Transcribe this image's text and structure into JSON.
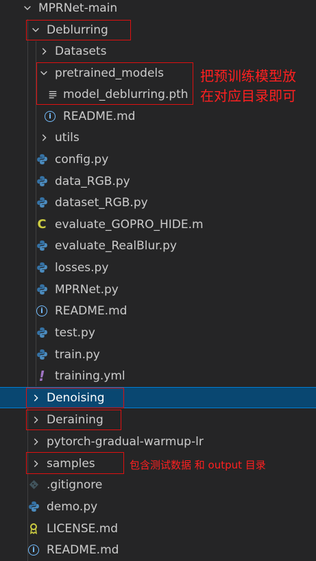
{
  "explorer": {
    "root_label": "MPRNet-main",
    "deblurring": "Deblurring",
    "datasets": "Datasets",
    "pretrained_models": "pretrained_models",
    "model_file": "model_deblurring.pth",
    "readme_sub": "README.md",
    "utils": "utils",
    "config": "config.py",
    "data_rgb": "data_RGB.py",
    "dataset_rgb": "dataset_RGB.py",
    "evaluate_gopro": "evaluate_GOPRO_HIDE.m",
    "evaluate_realblur": "evaluate_RealBlur.py",
    "losses": "losses.py",
    "mprnet": "MPRNet.py",
    "readme_deblur": "README.md",
    "test": "test.py",
    "train": "train.py",
    "training_yml": "training.yml",
    "denoising": "Denoising",
    "deraining": "Deraining",
    "pytorch_warmup": "pytorch-gradual-warmup-lr",
    "samples": "samples",
    "gitignore": ".gitignore",
    "demo": "demo.py",
    "license": "LICENSE.md",
    "readme_root": "README.md"
  },
  "annotations": {
    "note_pretrained_line1": "把预训练模型放",
    "note_pretrained_line2": "在对应目录即可",
    "note_samples": "包含测试数据  和 output 目录"
  },
  "colors": {
    "background": "#252526",
    "selected": "#094771",
    "annotation_red": "#e01010",
    "python_blue": "#3572a5",
    "python_yellow": "#ffd43b"
  }
}
